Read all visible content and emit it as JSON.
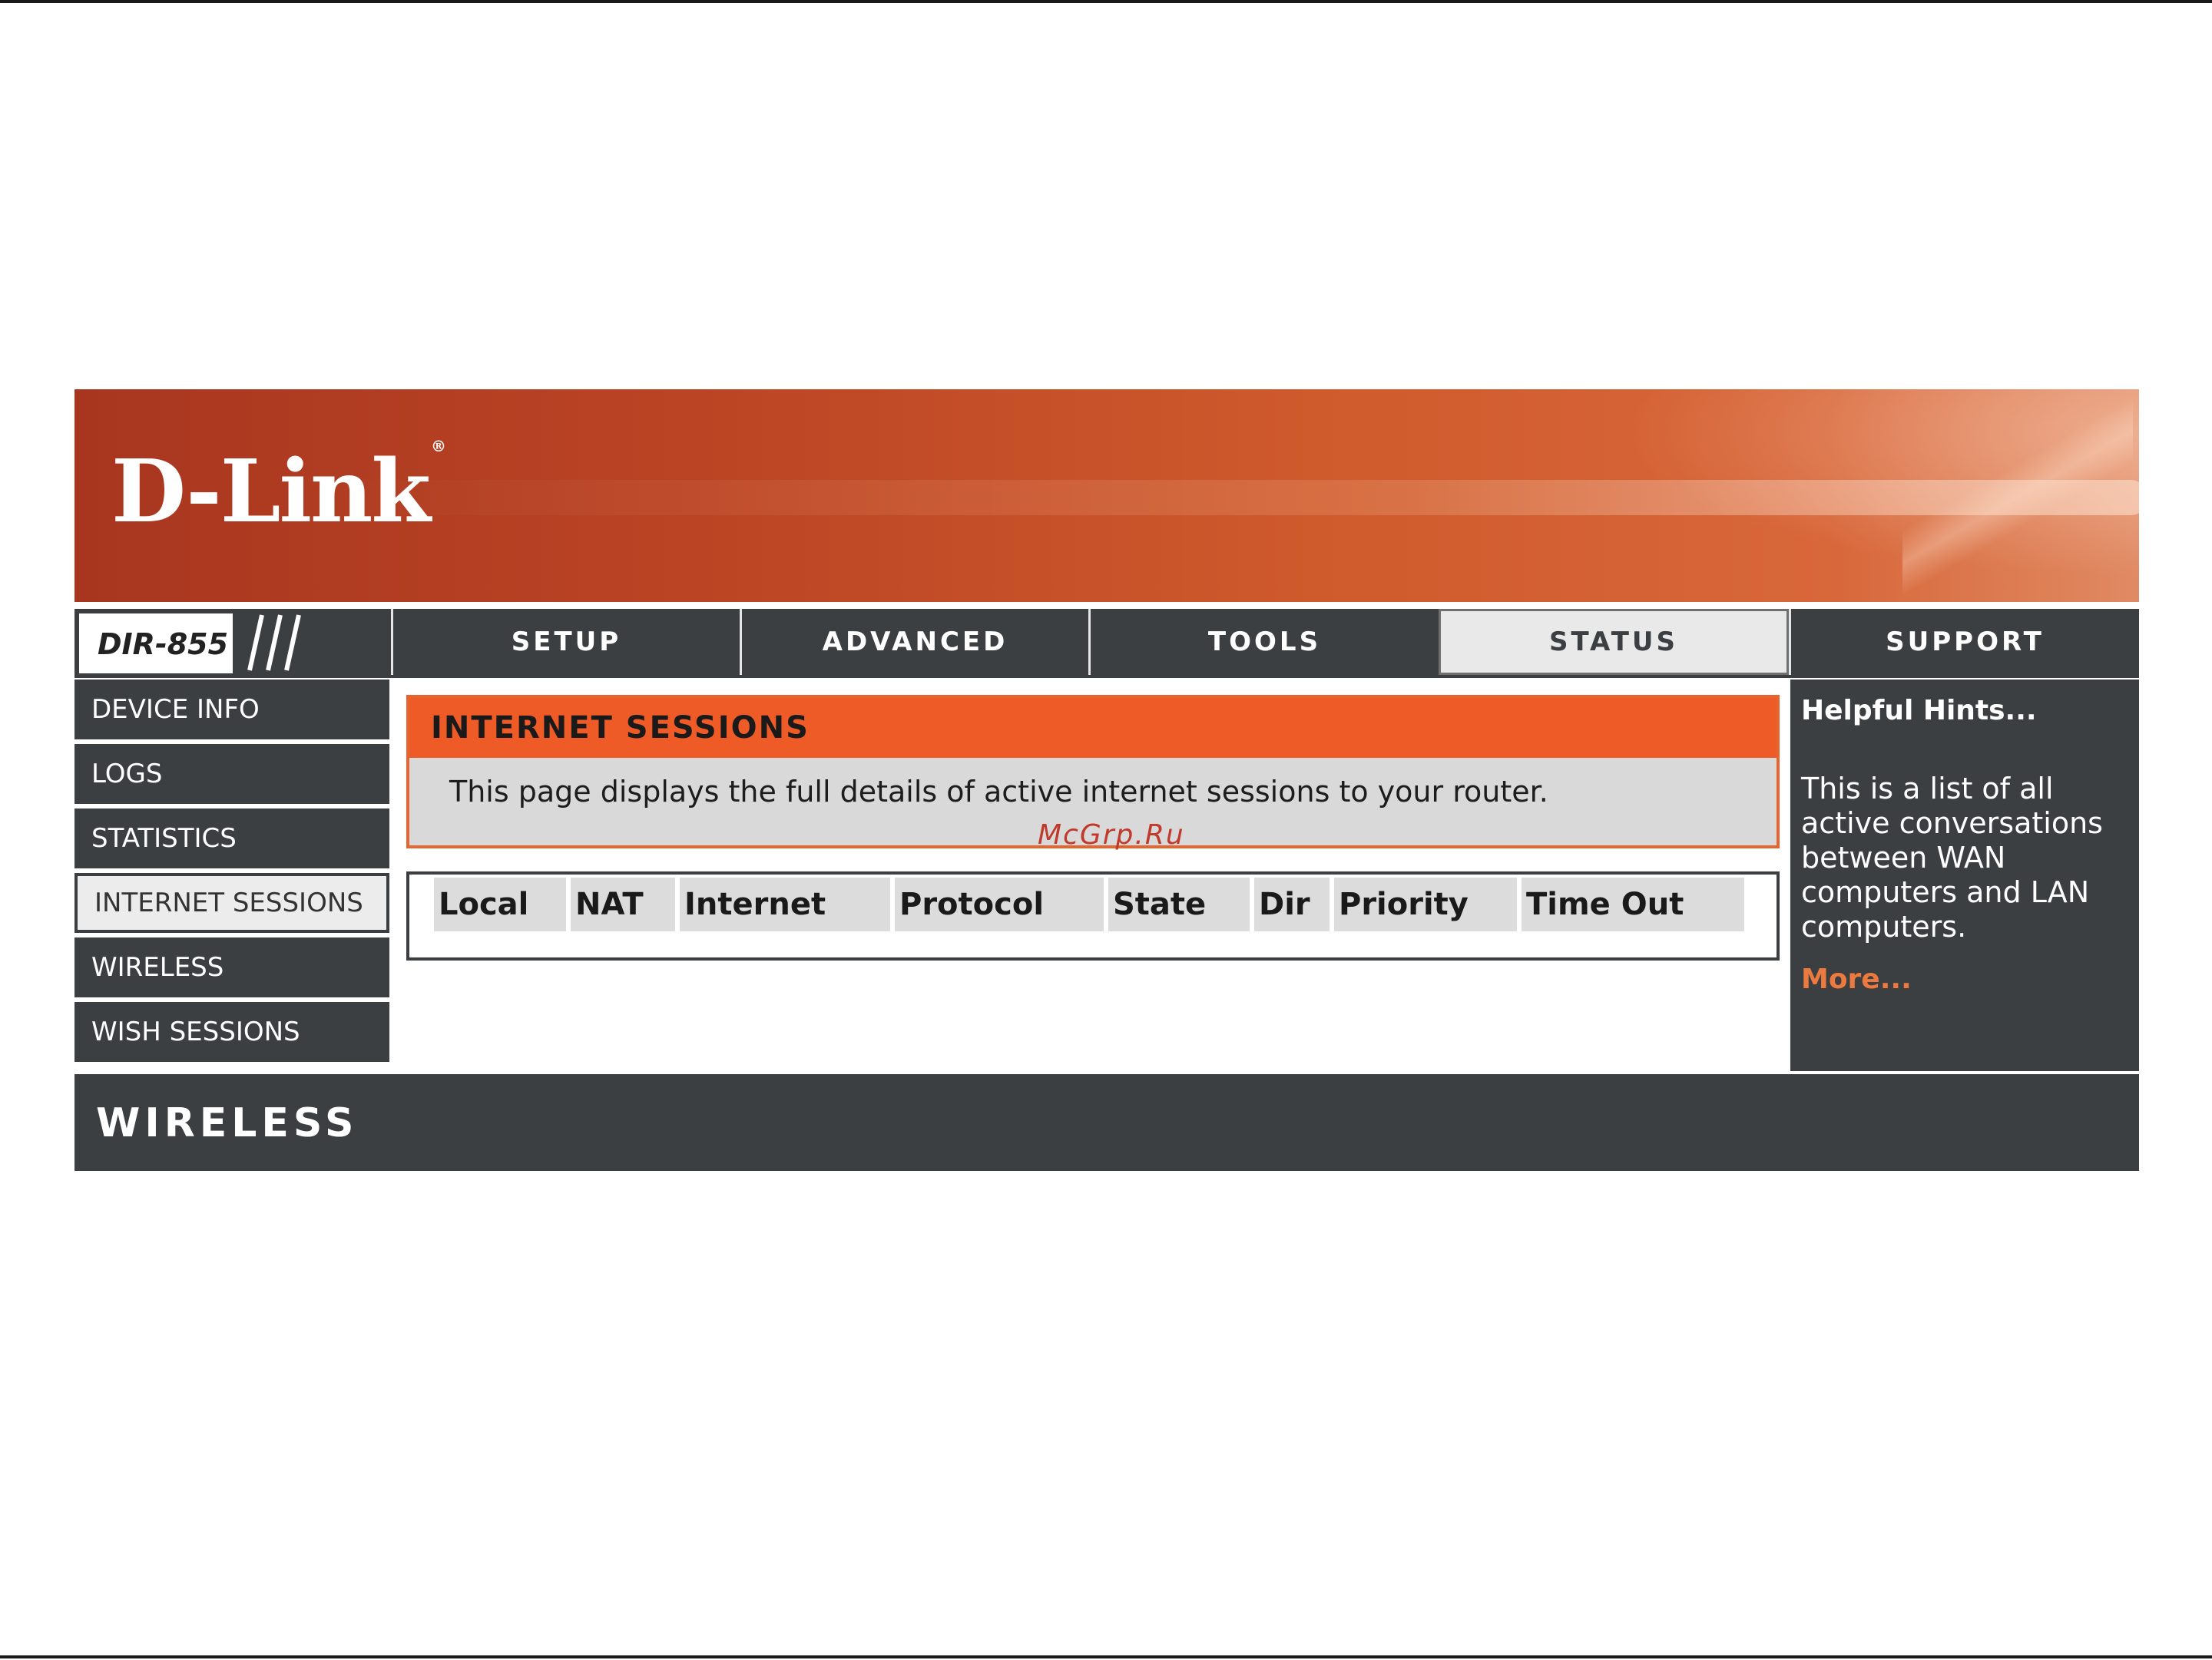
{
  "brand": {
    "logo_text": "D-Link",
    "registered_mark": "®",
    "model": "DIR-855"
  },
  "topnav": {
    "tabs": [
      {
        "label": "SETUP",
        "active": false
      },
      {
        "label": "ADVANCED",
        "active": false
      },
      {
        "label": "TOOLS",
        "active": false
      },
      {
        "label": "STATUS",
        "active": true
      },
      {
        "label": "SUPPORT",
        "active": false
      }
    ]
  },
  "sidebar": {
    "items": [
      {
        "label": "DEVICE INFO",
        "active": false
      },
      {
        "label": "LOGS",
        "active": false
      },
      {
        "label": "STATISTICS",
        "active": false
      },
      {
        "label": "INTERNET SESSIONS",
        "active": true
      },
      {
        "label": "WIRELESS",
        "active": false
      },
      {
        "label": "WISH SESSIONS",
        "active": false
      }
    ]
  },
  "main": {
    "section_title": "INTERNET SESSIONS",
    "description": "This page displays the full details of active internet sessions to your router.",
    "watermark": "McGrp.Ru",
    "table": {
      "columns": [
        "Local",
        "NAT",
        "Internet",
        "Protocol",
        "State",
        "Dir",
        "Priority",
        "Time Out"
      ],
      "rows": []
    }
  },
  "hints": {
    "title": "Helpful Hints...",
    "body": "This is a list of all active conversations between WAN computers and LAN computers.",
    "more": "More..."
  },
  "footer": {
    "label": "WIRELESS"
  },
  "colors": {
    "banner": "#bb4424",
    "nav_dark": "#3b3f42",
    "section_header": "#ef5b27",
    "section_body": "#d9d9d9",
    "link_orange": "#ec7a3e"
  }
}
